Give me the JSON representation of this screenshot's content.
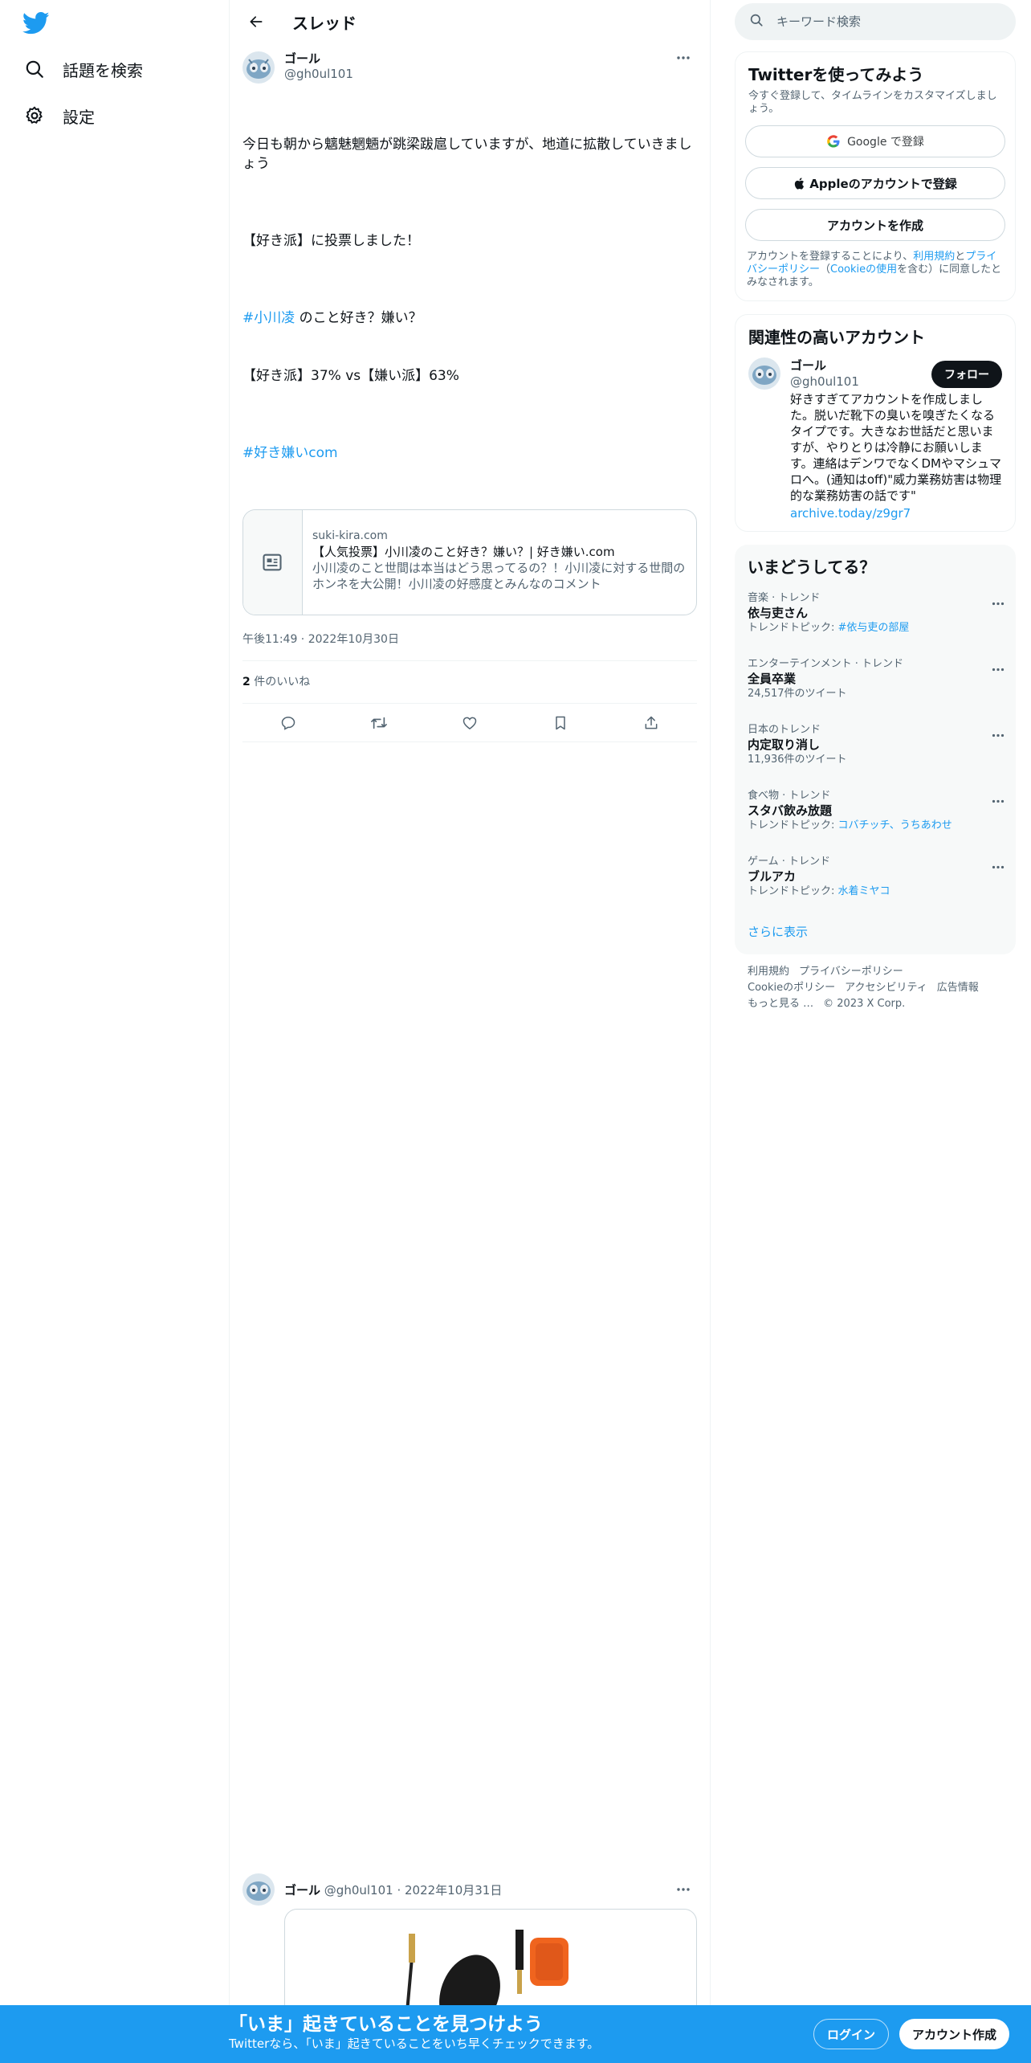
{
  "nav": {
    "explore_label": "話題を検索",
    "settings_label": "設定"
  },
  "header": {
    "title": "スレッド"
  },
  "tweet": {
    "author_name": "ゴール",
    "author_handle": "@gh0ul101",
    "text_line1": "今日も朝から魑魅魍魎が跳梁跋扈していますが、地道に拡散していきましょう",
    "text_line2": "【好き派】に投票しました！",
    "hashtag1": "#小川凌",
    "text_line3_rest": " のこと好き？嫌い？",
    "text_line4": "【好き派】37% vs【嫌い派】63%",
    "hashtag2": "#好き嫌いcom",
    "card": {
      "domain": "suki-kira.com",
      "title": "【人気投票】小川凌のこと好き？嫌い？| 好き嫌い.com",
      "description": "小川凌のこと世間は本当はどう思ってるの？！小川凌に対する世間のホンネを大公開！小川凌の好感度とみんなのコメント"
    },
    "timestamp": "午後11:49 · 2022年10月30日",
    "likes_count": "2",
    "likes_label": " 件のいいね"
  },
  "reply": {
    "author_name": "ゴール",
    "author_handle": "@gh0ul101",
    "date": "· 2022年10月31日"
  },
  "search": {
    "placeholder": "キーワード検索"
  },
  "signup_box": {
    "title": "Twitterを使ってみよう",
    "subtitle": "今すぐ登録して、タイムラインをカスタマイズしましょう。",
    "google_label": "Google で登録",
    "apple_label": "Appleのアカウントで登録",
    "create_label": "アカウントを作成",
    "fine_pre": "アカウントを登録することにより、",
    "fine_terms": "利用規約",
    "fine_and": "と",
    "fine_privacy": "プライバシーポリシー",
    "fine_cookie_pre": "（",
    "fine_cookie": "Cookieの使用",
    "fine_post": "を含む）に同意したとみなされます。"
  },
  "related": {
    "title": "関連性の高いアカウント",
    "name": "ゴール",
    "handle": "@gh0ul101",
    "follow_label": "フォロー",
    "bio": "好きすぎてアカウントを作成しました。脱いだ靴下の臭いを嗅ぎたくなるタイプです。大きなお世話だと思いますが、やりとりは冷静にお願いします。連絡はデンワでなくDMやマシュマロへ。(通知はoff)\"威力業務妨害は物理的な業務妨害の話です\"",
    "link": "archive.today/z9gr7"
  },
  "trends": {
    "title": "いまどうしてる？",
    "items": [
      {
        "category": "音楽 · トレンド",
        "title": "依与吏さん",
        "sub_pre": "トレンドトピック: ",
        "sub_link": "#依与吏の部屋"
      },
      {
        "category": "エンターテインメント · トレンド",
        "title": "全員卒業",
        "sub_pre": "24,517件のツイート",
        "sub_link": ""
      },
      {
        "category": "日本のトレンド",
        "title": "内定取り消し",
        "sub_pre": "11,936件のツイート",
        "sub_link": ""
      },
      {
        "category": "食べ物 · トレンド",
        "title": "スタバ飲み放題",
        "sub_pre": "トレンドトピック: ",
        "sub_link": "コバチッチ、うちあわせ"
      },
      {
        "category": "ゲーム · トレンド",
        "title": "ブルアカ",
        "sub_pre": "トレンドトピック: ",
        "sub_link": "水着ミヤコ"
      }
    ],
    "show_more": "さらに表示"
  },
  "footer": {
    "terms": "利用規約",
    "privacy": "プライバシーポリシー",
    "cookie": "Cookieのポリシー",
    "accessibility": "アクセシビリティ",
    "ads": "広告情報",
    "more": "もっと見る …",
    "copyright": "© 2023 X Corp."
  },
  "bottom_bar": {
    "title": "「いま」起きていることを見つけよう",
    "subtitle": "Twitterなら、「いま」起きていることをいち早くチェックできます。",
    "login_label": "ログイン",
    "signup_label": "アカウント作成"
  },
  "colors": {
    "brand": "#1d9bf0",
    "text": "#0f1419",
    "secondary": "#536471"
  },
  "icons": [
    "twitter-logo-icon",
    "search-icon",
    "gear-icon",
    "back-arrow-icon",
    "more-dots-icon",
    "article-icon",
    "reply-icon",
    "retweet-icon",
    "like-icon",
    "bookmark-icon",
    "share-icon",
    "google-icon",
    "apple-icon"
  ]
}
